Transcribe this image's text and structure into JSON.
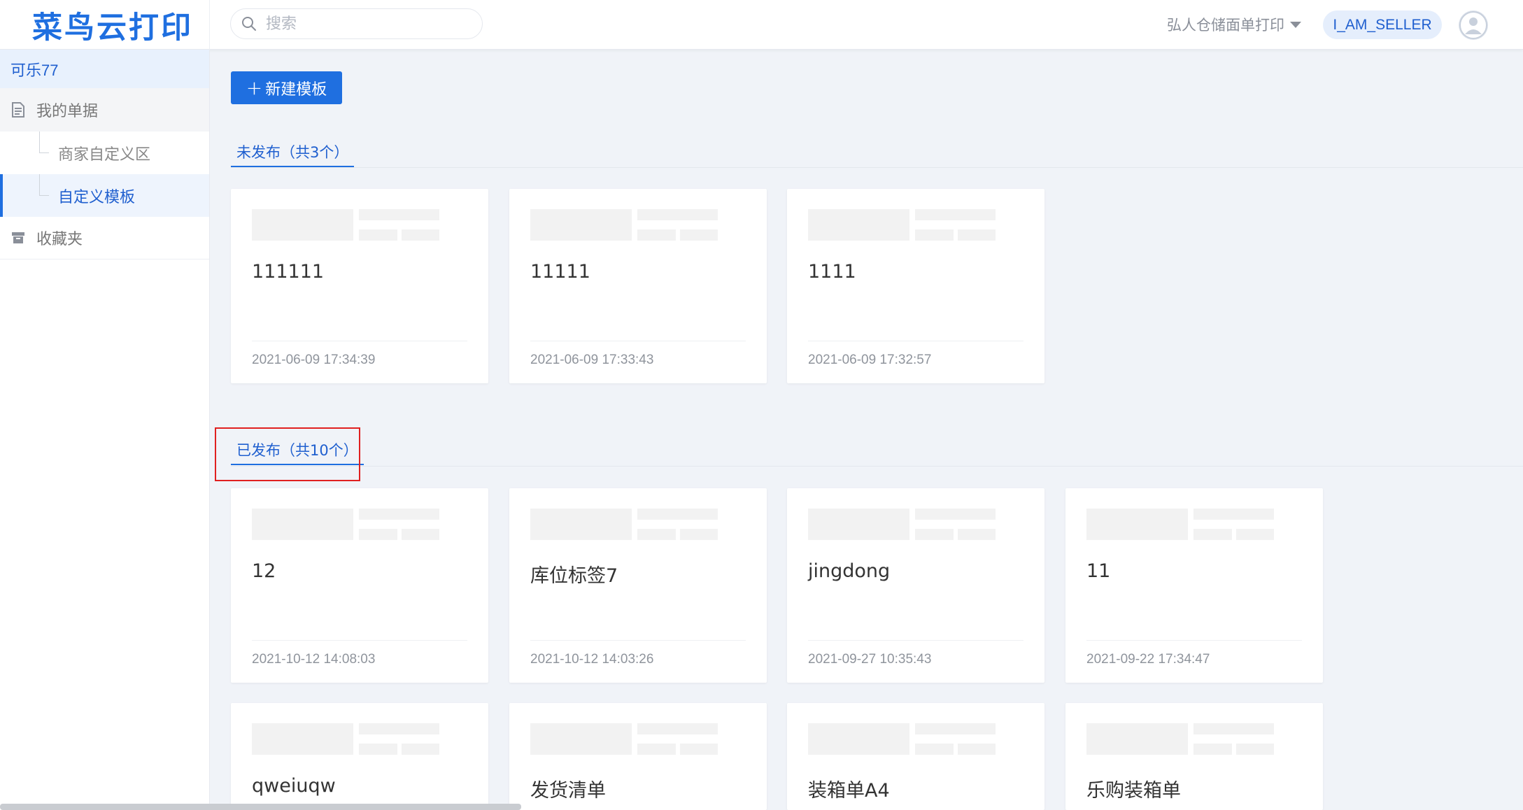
{
  "app": {
    "logo": "菜鸟云打印"
  },
  "header": {
    "search_placeholder": "搜索",
    "shop_name": "弘人仓储面单打印",
    "role": "I_AM_SELLER",
    "avatar_icon": "user-avatar-icon"
  },
  "sidebar": {
    "user": "可乐77",
    "group": {
      "label": "我的单据",
      "icon": "document-icon"
    },
    "items": [
      {
        "label": "商家自定义区",
        "active": false
      },
      {
        "label": "自定义模板",
        "active": true
      }
    ],
    "favorites": {
      "label": "收藏夹",
      "icon": "archive-icon"
    }
  },
  "toolbar": {
    "new_template": "新建模板",
    "plus_icon": "plus-icon"
  },
  "sections": {
    "unpublished": {
      "tab_label": "未发布（共3个）",
      "cards": [
        {
          "name": "111111",
          "date": "2021-06-09 17:34:39"
        },
        {
          "name": "11111",
          "date": "2021-06-09 17:33:43"
        },
        {
          "name": "1111",
          "date": "2021-06-09 17:32:57"
        }
      ]
    },
    "published": {
      "tab_label": "已发布（共10个）",
      "cards": [
        {
          "name": "12",
          "date": "2021-10-12 14:08:03"
        },
        {
          "name": "库位标签7",
          "date": "2021-10-12 14:03:26"
        },
        {
          "name": "jingdong",
          "date": "2021-09-27 10:35:43"
        },
        {
          "name": "11",
          "date": "2021-09-22 17:34:47"
        },
        {
          "name": "qweiuqw",
          "date": ""
        },
        {
          "name": "发货清单",
          "date": ""
        },
        {
          "name": "装箱单A4",
          "date": ""
        },
        {
          "name": "乐购装箱单",
          "date": ""
        }
      ]
    }
  },
  "colors": {
    "accent": "#1f6fe0",
    "highlight": "#e02020",
    "background": "#f0f3f8"
  }
}
